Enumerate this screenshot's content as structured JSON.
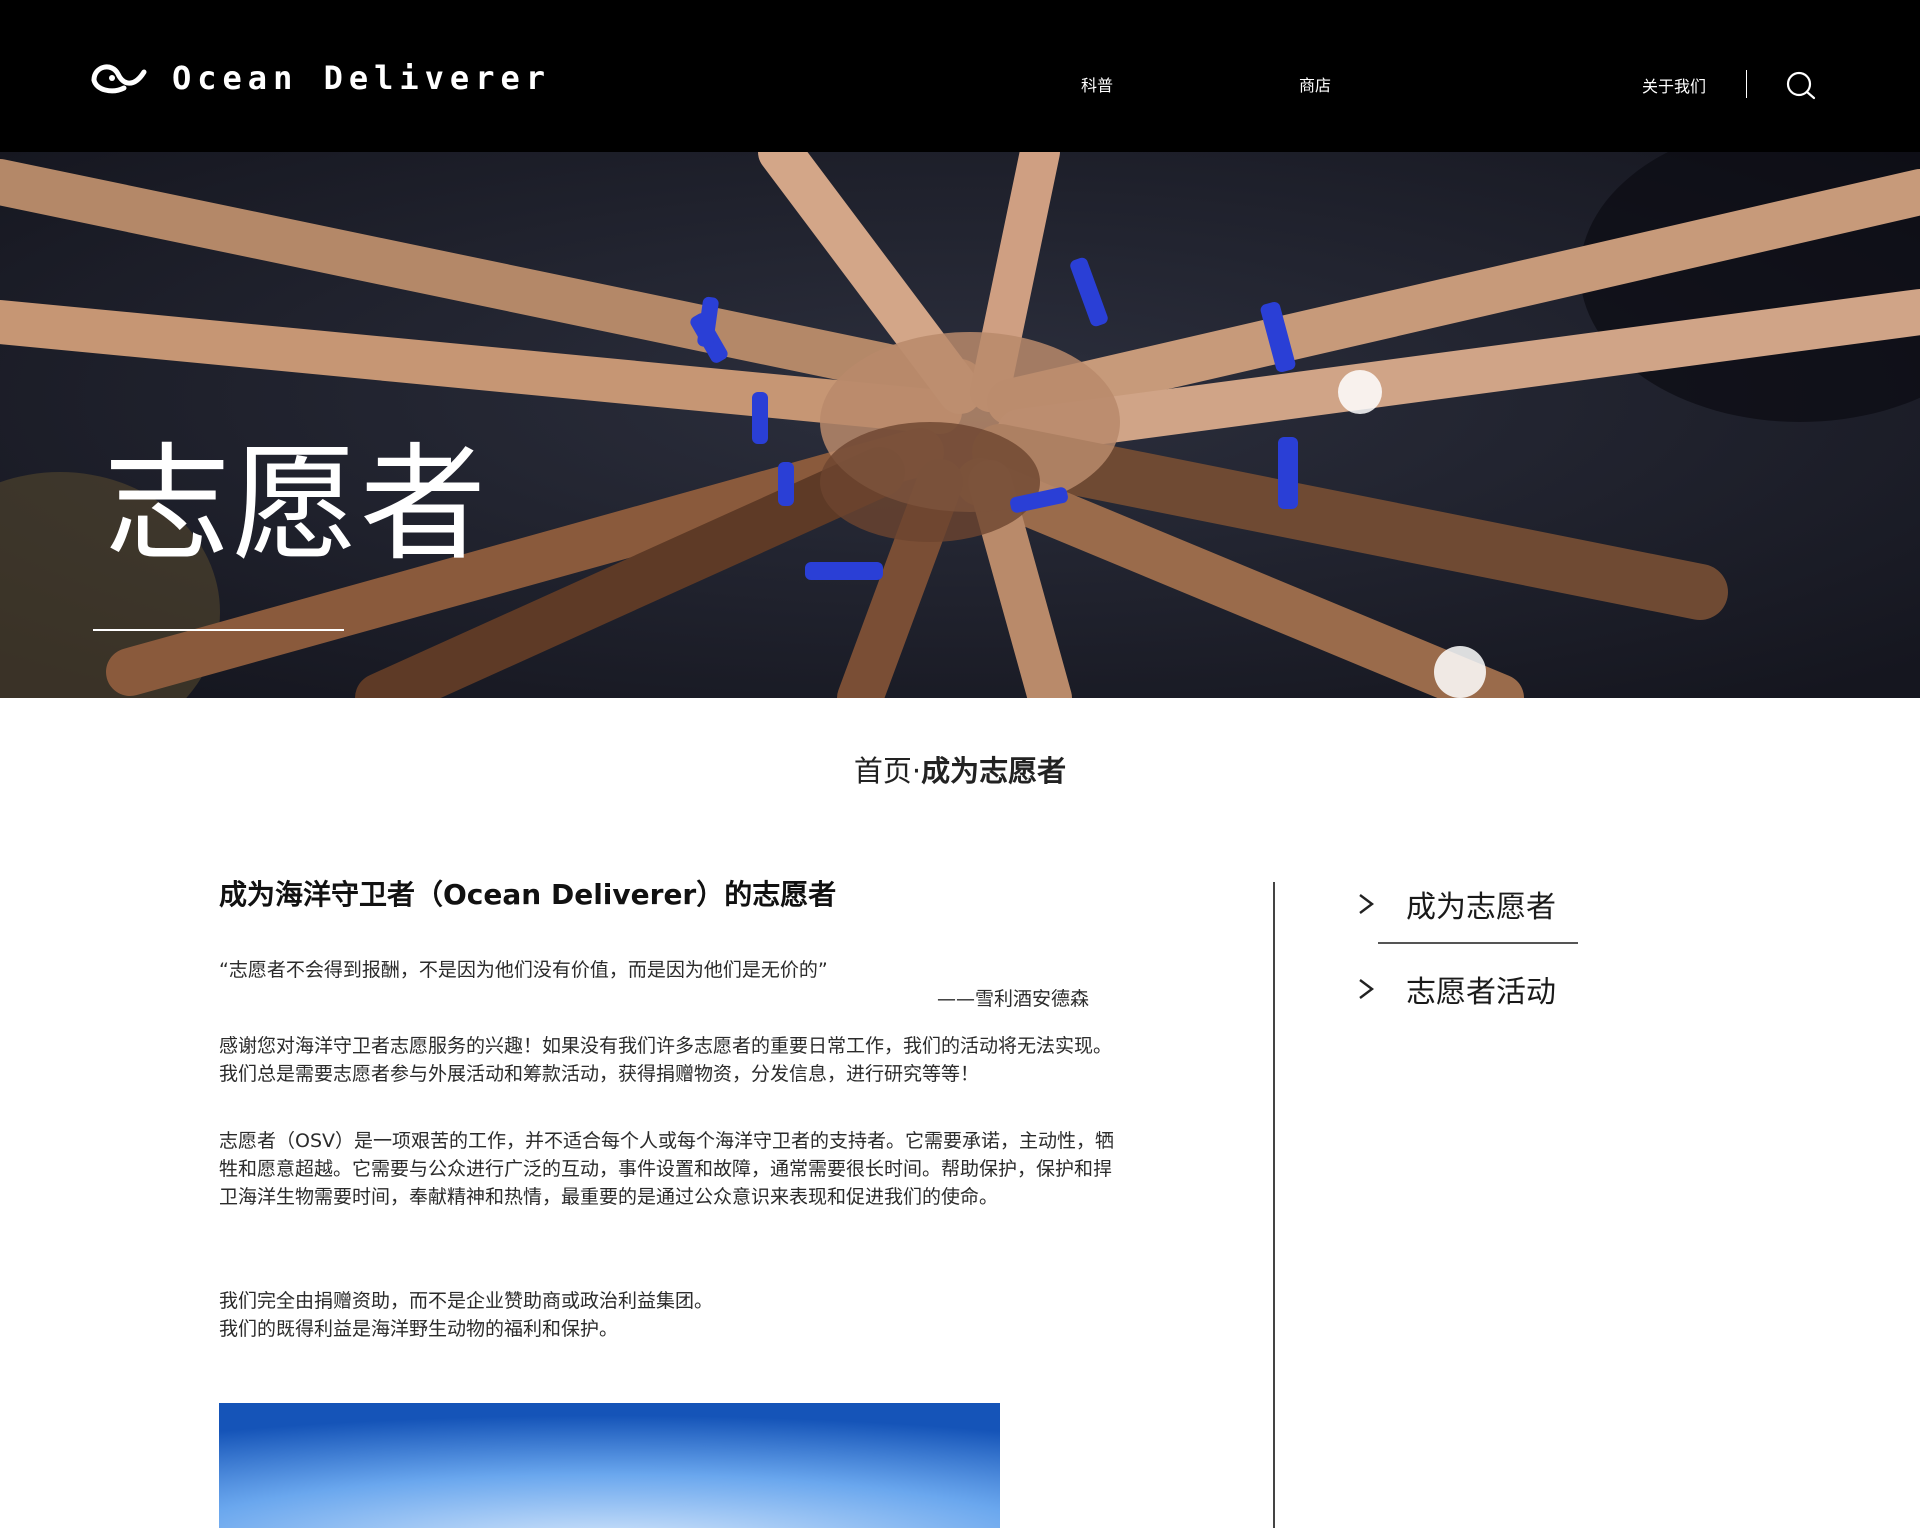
{
  "header": {
    "brand": "Ocean Deliverer",
    "nav": {
      "science": "科普",
      "shop": "商店",
      "about": "关于我们"
    },
    "search_icon": "search-icon"
  },
  "hero": {
    "title": "志愿者",
    "background": "photo of many hands stacked together wearing blue wristbands"
  },
  "breadcrumb": {
    "home": "首页",
    "separator": "·",
    "current": "成为志愿者"
  },
  "article": {
    "title": "成为海洋守卫者（Ocean Deliverer）的志愿者",
    "quote": "“志愿者不会得到报酬，不是因为他们没有价值，而是因为他们是无价的”",
    "quote_author": "——雪利酒安德森",
    "paragraph_1": "感谢您对海洋守卫者志愿服务的兴趣！如果没有我们许多志愿者的重要日常工作，我们的活动将无法实现。我们总是需要志愿者参与外展活动和筹款活动，获得捐赠物资，分发信息，进行研究等等！",
    "paragraph_2": "志愿者（OSV）是一项艰苦的工作，并不适合每个人或每个海洋守卫者的支持者。它需要承诺，主动性，牺牲和愿意超越。它需要与公众进行广泛的互动，事件设置和故障，通常需要很长时间。帮助保护，保护和捍卫海洋生物需要时间，奉献精神和热情，最重要的是通过公众意识来表现和促进我们的使命。",
    "paragraph_3_line_1": "我们完全由捐赠资助，而不是企业赞助商或政治利益集团。",
    "paragraph_3_line_2": "我们的既得利益是海洋野生动物的福利和保护。"
  },
  "sidebar": {
    "items": [
      {
        "label": "成为志愿者",
        "icon": "chevron-right-icon",
        "active": true
      },
      {
        "label": "志愿者活动",
        "icon": "chevron-right-icon",
        "active": false
      }
    ]
  },
  "colors": {
    "header_bg": "#000000",
    "text": "#1a1a1a",
    "wristband_blue": "#2a3fd6",
    "sky_blue": "#1f6fd1"
  }
}
